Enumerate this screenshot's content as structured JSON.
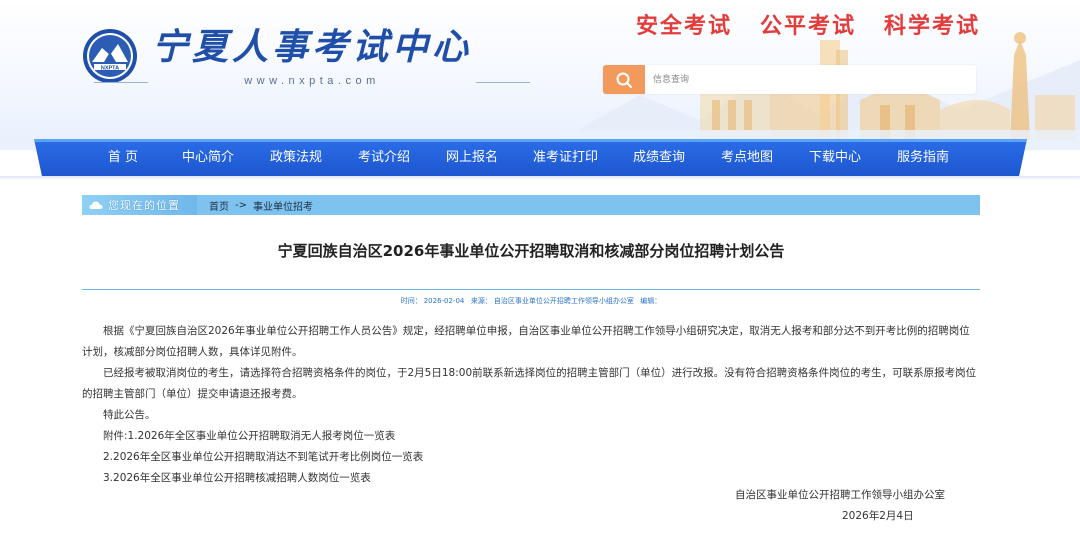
{
  "site": {
    "logo_title": "宁夏人事考试中心",
    "logo_emblem_text": "NXPTA",
    "logo_url": "www.nxpta.com",
    "slogans": [
      "安全考试",
      "公平考试",
      "科学考试"
    ],
    "search_placeholder": "信息查询",
    "brand_color": "#1f4fa8",
    "accent_color": "#e23c3c",
    "nav_color": "#2463db"
  },
  "nav": {
    "items": [
      "首 页",
      "中心简介",
      "政策法规",
      "考试介绍",
      "网上报名",
      "准考证打印",
      "成绩查询",
      "考点地图",
      "下载中心",
      "服务指南"
    ]
  },
  "location": {
    "label": "您现在的位置",
    "home": "首页",
    "separator": "->",
    "current": "事业单位招考"
  },
  "article": {
    "title": "宁夏回族自治区2026年事业单位公开招聘取消和核减部分岗位招聘计划公告",
    "meta_time_label": "时间：",
    "meta_time": "2026-02-04",
    "meta_source_label": "来源：",
    "meta_source": "自治区事业单位公开招聘工作领导小组办公室",
    "meta_editor_label": "编辑：",
    "paragraphs": [
      "根据《宁夏回族自治区2026年事业单位公开招聘工作人员公告》规定，经招聘单位申报，自治区事业单位公开招聘工作领导小组研究决定，取消无人报考和部分达不到开考比例的招聘岗位计划，核减部分岗位招聘人数，具体详见附件。",
      "已经报考被取消岗位的考生，请选择符合招聘资格条件的岗位，于2月5日18:00前联系新选择岗位的招聘主管部门（单位）进行改报。没有符合招聘资格条件岗位的考生，可联系原报考岗位的招聘主管部门（单位）提交申请退还报考费。",
      "特此公告。",
      "附件:1.2026年全区事业单位公开招聘取消无人报考岗位一览表",
      "2.2026年全区事业单位公开招聘取消达不到笔试开考比例岗位一览表",
      "3.2026年全区事业单位公开招聘核减招聘人数岗位一览表"
    ],
    "signature": "自治区事业单位公开招聘工作领导小组办公室",
    "date": "2026年2月4日"
  }
}
